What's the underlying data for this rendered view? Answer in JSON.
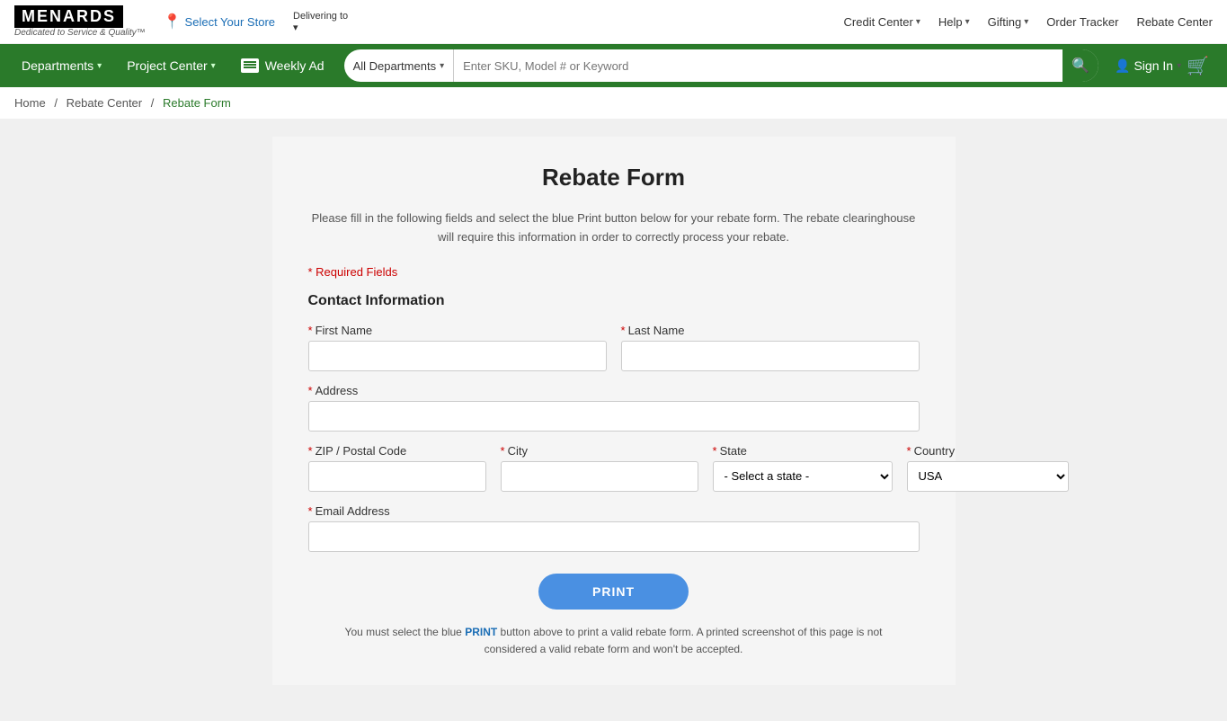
{
  "topbar": {
    "logo": "MENARDS",
    "logo_subtitle": "Dedicated to Service & Quality™",
    "store_label": "Select Your Store",
    "delivering_label": "Delivering to",
    "delivering_chevron": "▾",
    "links": [
      {
        "label": "Credit Center",
        "has_chevron": true
      },
      {
        "label": "Help",
        "has_chevron": true
      },
      {
        "label": "Gifting",
        "has_chevron": true
      },
      {
        "label": "Order Tracker",
        "has_chevron": false
      },
      {
        "label": "Rebate Center",
        "has_chevron": false
      }
    ]
  },
  "navbar": {
    "departments_label": "Departments",
    "project_center_label": "Project Center",
    "weekly_ad_label": "Weekly Ad",
    "search_dept_label": "All Departments",
    "search_placeholder": "Enter SKU, Model # or Keyword",
    "signin_label": "Sign In"
  },
  "breadcrumb": {
    "home": "Home",
    "rebate_center": "Rebate Center",
    "current": "Rebate Form"
  },
  "form": {
    "title": "Rebate Form",
    "description": "Please fill in the following fields and select the blue Print button below for your rebate form. The rebate clearinghouse will require this information in order to correctly process your rebate.",
    "required_note": "* Required Fields",
    "section_title": "Contact Information",
    "first_name_label": "First Name",
    "last_name_label": "Last Name",
    "address_label": "Address",
    "zip_label": "ZIP / Postal Code",
    "city_label": "City",
    "state_label": "State",
    "country_label": "Country",
    "email_label": "Email Address",
    "state_placeholder": "- Select a state -",
    "country_default": "USA",
    "print_button": "PRINT",
    "print_note_1": "You must select the blue PRINT button above to print a valid rebate form. A printed screenshot of this page is not",
    "print_note_2": "considered a valid rebate form and won't be accepted.",
    "required_asterisk": "*"
  }
}
